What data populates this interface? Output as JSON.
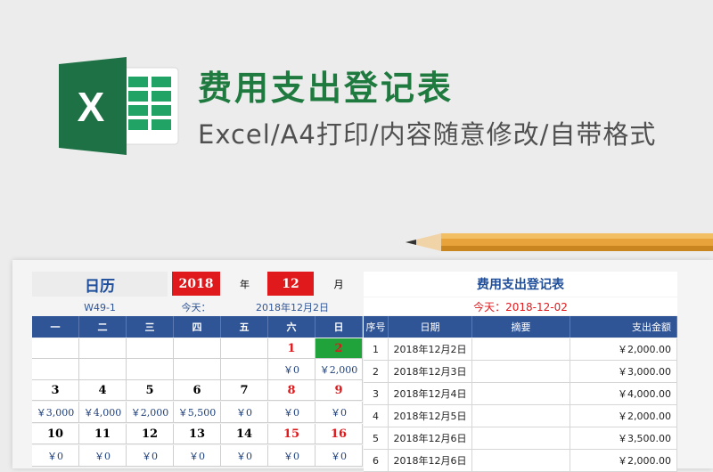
{
  "banner": {
    "title": "费用支出登记表",
    "subtitle": "Excel/A4打印/内容随意修改/自带格式",
    "logo_letter": "X",
    "brand_green": "#1f7a3f"
  },
  "calendar": {
    "title": "日历",
    "year": "2018",
    "year_unit": "年",
    "month": "12",
    "month_unit": "月",
    "week_label": "W49-1",
    "today_label": "今天：",
    "today_value": "2018年12月2日",
    "weekdays": [
      "一",
      "二",
      "三",
      "四",
      "五",
      "六",
      "日"
    ],
    "weeks": [
      {
        "days": [
          "",
          "",
          "",
          "",
          "",
          "1",
          "2"
        ],
        "amounts": [
          "",
          "",
          "",
          "",
          "",
          "￥0",
          "￥2,000"
        ]
      },
      {
        "days": [
          "3",
          "4",
          "5",
          "6",
          "7",
          "8",
          "9"
        ],
        "amounts": [
          "￥3,000",
          "￥4,000",
          "￥2,000",
          "￥5,500",
          "￥0",
          "￥0",
          "￥0"
        ]
      },
      {
        "days": [
          "10",
          "11",
          "12",
          "13",
          "14",
          "15",
          "16"
        ],
        "amounts": [
          "￥0",
          "￥0",
          "￥0",
          "￥0",
          "￥0",
          "￥0",
          "￥0"
        ]
      }
    ],
    "accent_red": "#e0191c",
    "header_blue": "#2f5597",
    "highlight_green": "#1fa33a"
  },
  "ledger": {
    "title": "费用支出登记表",
    "today_text": "今天：2018-12-02",
    "columns": [
      "序号",
      "日期",
      "摘要",
      "支出金额"
    ],
    "rows": [
      {
        "no": "1",
        "date": "2018年12月2日",
        "summary": "",
        "amount": "￥2,000.00"
      },
      {
        "no": "2",
        "date": "2018年12月3日",
        "summary": "",
        "amount": "￥3,000.00"
      },
      {
        "no": "3",
        "date": "2018年12月4日",
        "summary": "",
        "amount": "￥4,000.00"
      },
      {
        "no": "4",
        "date": "2018年12月5日",
        "summary": "",
        "amount": "￥2,000.00"
      },
      {
        "no": "5",
        "date": "2018年12月6日",
        "summary": "",
        "amount": "￥3,500.00"
      },
      {
        "no": "6",
        "date": "2018年12月6日",
        "summary": "",
        "amount": "￥2,000.00"
      }
    ]
  }
}
